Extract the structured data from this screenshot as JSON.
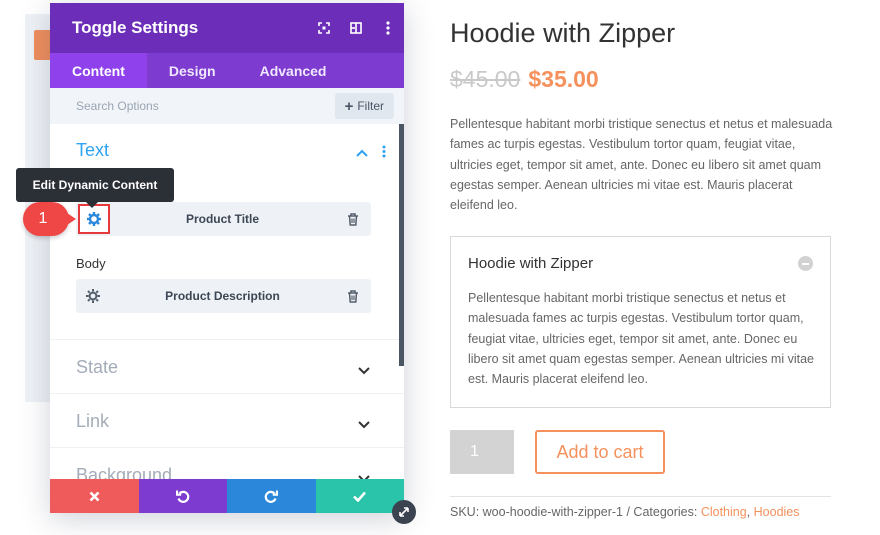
{
  "modal": {
    "title": "Toggle Settings",
    "tabs": [
      {
        "label": "Content",
        "active": true
      },
      {
        "label": "Design",
        "active": false
      },
      {
        "label": "Advanced",
        "active": false
      }
    ],
    "search": {
      "placeholder": "Search Options",
      "filter_label": "Filter"
    },
    "sections": {
      "text": {
        "title": "Text",
        "title_field_value": "Product Title",
        "body_label": "Body",
        "body_field_value": "Product Description"
      },
      "state": {
        "title": "State"
      },
      "link": {
        "title": "Link"
      },
      "background": {
        "title": "Background"
      }
    },
    "tooltip": "Edit Dynamic Content",
    "step_badge": "1"
  },
  "product": {
    "title": "Hoodie with Zipper",
    "price_old": "$45.00",
    "price_new": "$35.00",
    "description": "Pellentesque habitant morbi tristique senectus et netus et malesuada fames ac turpis egestas. Vestibulum tortor quam, feugiat vitae, ultricies eget, tempor sit amet, ante. Donec eu libero sit amet quam egestas semper. Aenean ultricies mi vitae est. Mauris placerat eleifend leo.",
    "toggle": {
      "title": "Hoodie with Zipper",
      "body": "Pellentesque habitant morbi tristique senectus et netus et malesuada fames ac turpis egestas. Vestibulum tortor quam, feugiat vitae, ultricies eget, tempor sit amet, ante. Donec eu libero sit amet quam egestas semper. Aenean ultricies mi vitae est. Mauris placerat eleifend leo."
    },
    "quantity": "1",
    "add_to_cart": "Add to cart",
    "sku_text": "SKU: woo-hoodie-with-zipper-1 / Categories: ",
    "category_1": "Clothing",
    "separator": ", ",
    "category_2": "Hoodies"
  },
  "colors": {
    "header_purple": "#6c2eb9",
    "tab_purple": "#7d3bcf",
    "accent_blue": "#2ea3f2",
    "price_orange": "#f5915c",
    "cancel_red": "#ef5b5b",
    "redo_blue": "#2b87da",
    "save_green": "#29c4a9"
  }
}
